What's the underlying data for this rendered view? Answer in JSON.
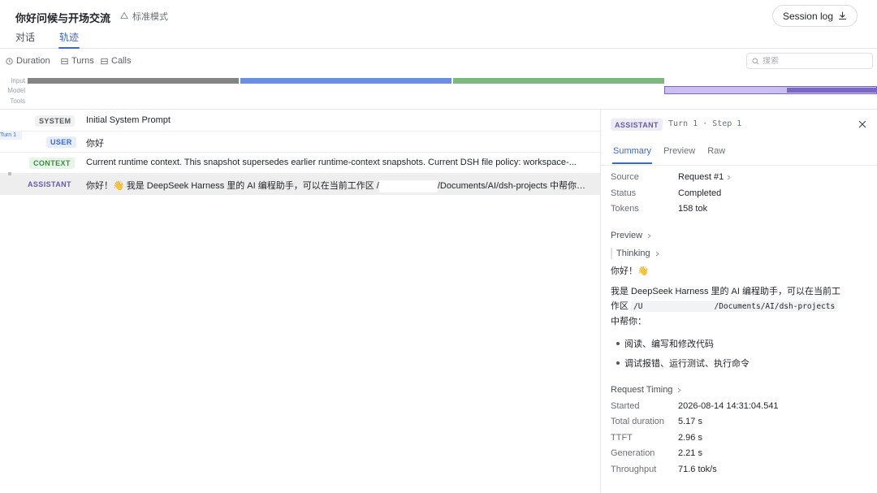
{
  "header": {
    "title": "你好问候与开场交流",
    "mode_label": "标准模式",
    "tabs": [
      {
        "label": "对话",
        "active": false
      },
      {
        "label": "轨迹",
        "active": true
      }
    ],
    "session_log_label": "Session log"
  },
  "filters": {
    "items": [
      {
        "label": "Duration",
        "icon": "clock-icon"
      },
      {
        "label": "Turns",
        "icon": "list-icon"
      },
      {
        "label": "Calls",
        "icon": "list-icon"
      }
    ],
    "search_placeholder": "搜索"
  },
  "timeline": {
    "lanes": [
      "Input",
      "Model",
      "Tools"
    ],
    "colors": {
      "input": "#858585",
      "model": "#6b8fe0",
      "tools": "#7cb87f",
      "assistant": "#7a68c2"
    }
  },
  "rows": [
    {
      "role": "SYSTEM",
      "text": "Initial System Prompt"
    },
    {
      "role": "USER",
      "text": "你好"
    },
    {
      "role": "CONTEXT",
      "text": "Current runtime context. This snapshot supersedes earlier runtime-context snapshots. Current DSH file policy: workspace-..."
    },
    {
      "role": "ASSISTANT",
      "text_before": "你好！👋 我是 DeepSeek Harness 里的 AI 编程助手，可以在当前工作区 /",
      "text_after": "/Documents/AI/dsh-projects 中帮你：  ..."
    }
  ],
  "turn_label": "Turn 1",
  "panel": {
    "badge": "ASSISTANT",
    "step": "Turn 1 · Step 1",
    "tabs": [
      {
        "label": "Summary",
        "active": true
      },
      {
        "label": "Preview",
        "active": false
      },
      {
        "label": "Raw",
        "active": false
      }
    ],
    "summary": {
      "source_label": "Source",
      "source_value": "Request #1",
      "status_label": "Status",
      "status_value": "Completed",
      "tokens_label": "Tokens",
      "tokens_value": "158 tok"
    },
    "preview": {
      "title": "Preview",
      "thinking": "Thinking",
      "greeting": "你好！👋",
      "line1": "我是 DeepSeek Harness 里的 AI 编程助手，可以在当前工",
      "line2_prefix": "作区",
      "path_start": "/U",
      "path_end": "/Documents/AI/dsh-projects",
      "line3": "中帮你：",
      "bullets": [
        "阅读、编写和修改代码",
        "调试报错、运行测试、执行命令"
      ]
    },
    "timing": {
      "title": "Request Timing",
      "items": [
        {
          "label": "Started",
          "value": "2026-08-14 14:31:04.541"
        },
        {
          "label": "Total duration",
          "value": "5.17 s"
        },
        {
          "label": "TTFT",
          "value": "2.96 s"
        },
        {
          "label": "Generation",
          "value": "2.21 s"
        },
        {
          "label": "Throughput",
          "value": "71.6 tok/s"
        }
      ]
    }
  }
}
